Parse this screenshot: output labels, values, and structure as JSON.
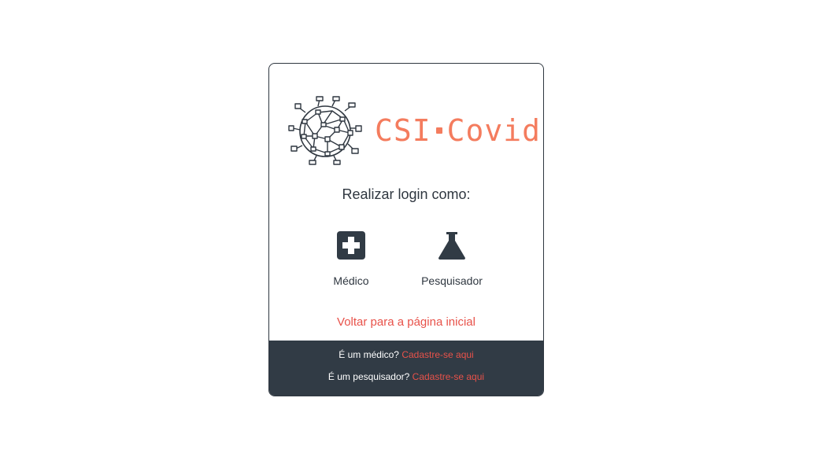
{
  "brand": {
    "part1": "CSI",
    "part2": "Covid",
    "logo_icon": "virus-icon",
    "color": "#f47c5e"
  },
  "login": {
    "heading": "Realizar login como:",
    "options": [
      {
        "label": "Médico",
        "icon": "medical-cross-icon"
      },
      {
        "label": "Pesquisador",
        "icon": "flask-icon"
      }
    ],
    "back_link": "Voltar para a página inicial"
  },
  "footer": {
    "doctor_prompt": "É um médico?",
    "doctor_link": "Cadastre-se aqui",
    "researcher_prompt": "É um pesquisador?",
    "researcher_link": "Cadastre-se aqui"
  },
  "colors": {
    "accent": "#e8524a",
    "dark": "#313b45"
  }
}
